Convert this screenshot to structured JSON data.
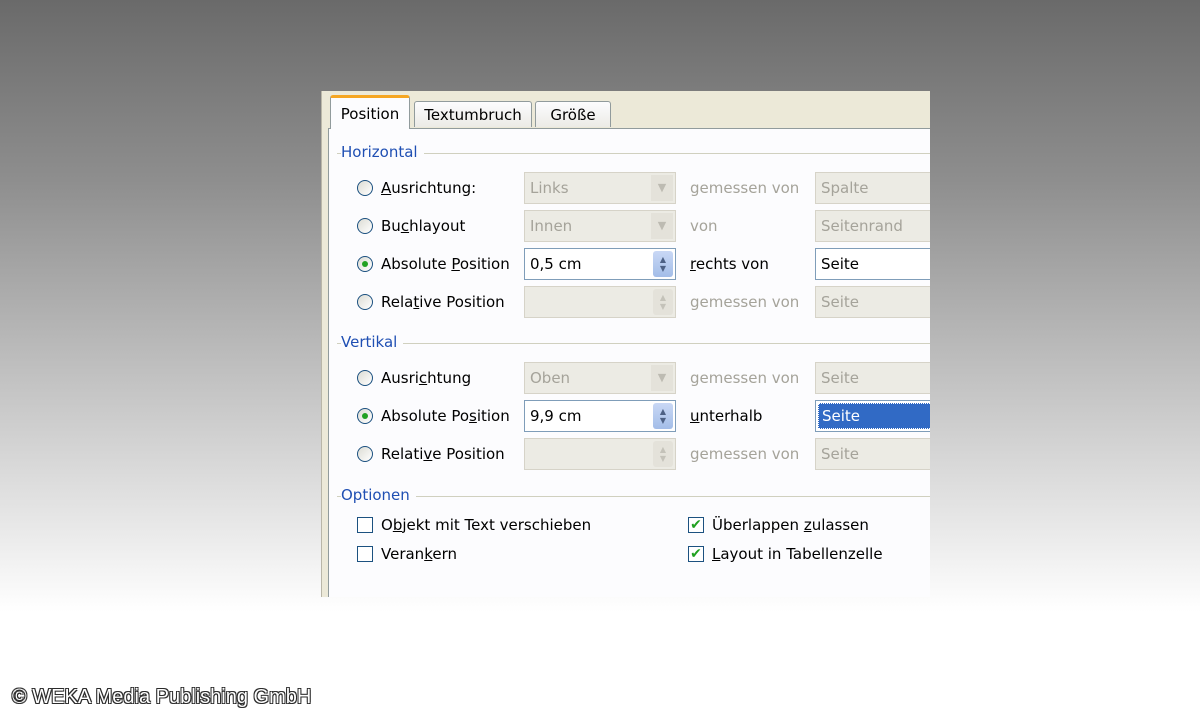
{
  "tabs": [
    {
      "label": "Position",
      "active": true
    },
    {
      "label": "Textumbruch",
      "active": false
    },
    {
      "label": "Größe",
      "active": false
    }
  ],
  "horizontal": {
    "title": "Horizontal",
    "rows": [
      {
        "label": "Ausrichtung:",
        "checked": false,
        "field": "Links",
        "relation": "gemessen von",
        "target": "Spalte"
      },
      {
        "label": "Buchlayout",
        "checked": false,
        "field": "Innen",
        "relation": "von",
        "target": "Seitenrand"
      },
      {
        "label": "Absolute Position",
        "checked": true,
        "field": "0,5 cm",
        "relation": "rechts von",
        "target": "Seite"
      },
      {
        "label": "Relative Position",
        "checked": false,
        "field": "",
        "relation": "gemessen von",
        "target": "Seite"
      }
    ]
  },
  "vertical": {
    "title": "Vertikal",
    "rows": [
      {
        "label": "Ausrichtung",
        "checked": false,
        "field": "Oben",
        "relation": "gemessen von",
        "target": "Seite"
      },
      {
        "label": "Absolute Position",
        "checked": true,
        "field": "9,9 cm",
        "relation": "unterhalb",
        "target": "Seite"
      },
      {
        "label": "Relative Position",
        "checked": false,
        "field": "",
        "relation": "gemessen von",
        "target": "Seite"
      }
    ]
  },
  "options": {
    "title": "Optionen",
    "items": [
      {
        "label": "Objekt mit Text verschieben",
        "checked": false
      },
      {
        "label": "Verankern",
        "checked": false
      },
      {
        "label": "Überlappen zulassen",
        "checked": true
      },
      {
        "label": "Layout in Tabellenzelle",
        "checked": true
      }
    ]
  },
  "copyright": "© WEKA Media Publishing GmbH",
  "colors": {
    "group_title": "#1f4fb3",
    "tab_highlight": "#f5a623",
    "selection": "#316ac5",
    "check_mark": "#21a121"
  }
}
